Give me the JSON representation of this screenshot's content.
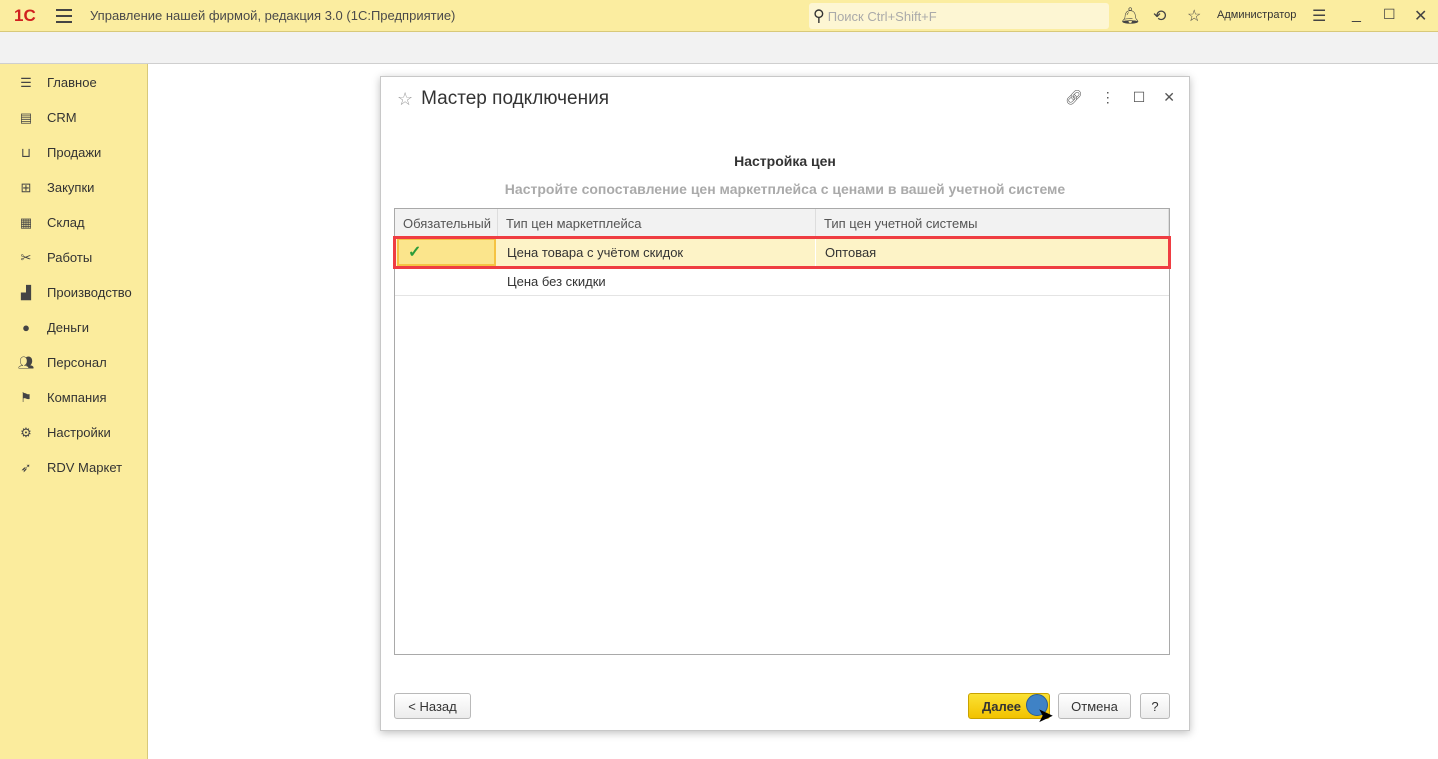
{
  "app": {
    "logo": "1С",
    "title": "Управление нашей фирмой, редакция 3.0  (1С:Предприятие)",
    "search_placeholder": "Поиск Ctrl+Shift+F",
    "user": "Администратор"
  },
  "sidebar": {
    "items": [
      {
        "label": "Главное",
        "icon": "menu-lines-icon"
      },
      {
        "label": "CRM",
        "icon": "contact-card-icon"
      },
      {
        "label": "Продажи",
        "icon": "basket-icon"
      },
      {
        "label": "Закупки",
        "icon": "cart-icon"
      },
      {
        "label": "Склад",
        "icon": "grid-icon"
      },
      {
        "label": "Работы",
        "icon": "tools-icon"
      },
      {
        "label": "Производство",
        "icon": "factory-icon"
      },
      {
        "label": "Деньги",
        "icon": "ruble-icon"
      },
      {
        "label": "Персонал",
        "icon": "people-icon"
      },
      {
        "label": "Компания",
        "icon": "flag-icon"
      },
      {
        "label": "Настройки",
        "icon": "gear-icon"
      },
      {
        "label": "RDV Маркет",
        "icon": "rocket-icon"
      }
    ]
  },
  "dialog": {
    "title": "Мастер подключения",
    "heading": "Настройка цен",
    "subheading": "Настройте сопоставление цен маркетплейса с ценами в вашей учетной системе",
    "columns": [
      "Обязательный",
      "Тип цен маркетплейса",
      "Тип цен учетной системы"
    ],
    "rows": [
      {
        "required": "✓",
        "market": "Цена товара с учётом скидок",
        "system": "Оптовая"
      },
      {
        "required": "",
        "market": "Цена без скидки",
        "system": ""
      }
    ],
    "back": "< Назад",
    "next": "Далее",
    "cancel": "Отмена",
    "help": "?"
  },
  "colors": {
    "accent": "#fbeda0",
    "highlight": "#ef3d42",
    "primary_button": "#f2c200"
  }
}
